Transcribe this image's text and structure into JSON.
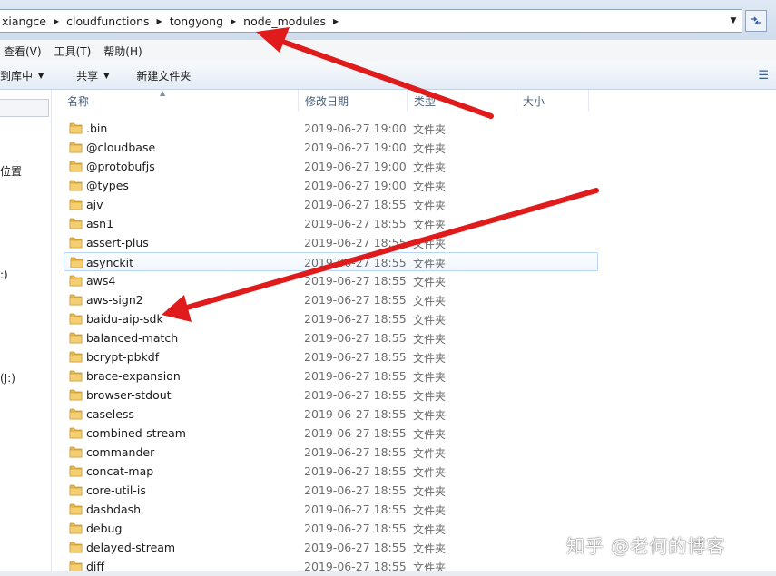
{
  "address_bar": {
    "crumbs": [
      "xiangce",
      "cloudfunctions",
      "tongyong",
      "node_modules"
    ]
  },
  "menu": [
    "查看(V)",
    "工具(T)",
    "帮助(H)"
  ],
  "toolbar": {
    "library_label": "到库中",
    "share_label": "共享",
    "new_folder_label": "新建文件夹"
  },
  "nav_pane": {
    "items": [
      "位置",
      ":)",
      "(J:)"
    ]
  },
  "columns": {
    "name": "名称",
    "date": "修改日期",
    "type": "类型",
    "size": "大小"
  },
  "files": [
    {
      "name": ".bin",
      "date": "2019-06-27 19:00",
      "type": "文件夹"
    },
    {
      "name": "@cloudbase",
      "date": "2019-06-27 19:00",
      "type": "文件夹"
    },
    {
      "name": "@protobufjs",
      "date": "2019-06-27 19:00",
      "type": "文件夹"
    },
    {
      "name": "@types",
      "date": "2019-06-27 19:00",
      "type": "文件夹"
    },
    {
      "name": "ajv",
      "date": "2019-06-27 18:55",
      "type": "文件夹"
    },
    {
      "name": "asn1",
      "date": "2019-06-27 18:55",
      "type": "文件夹"
    },
    {
      "name": "assert-plus",
      "date": "2019-06-27 18:55",
      "type": "文件夹"
    },
    {
      "name": "asynckit",
      "date": "2019-06-27 18:55",
      "type": "文件夹"
    },
    {
      "name": "aws4",
      "date": "2019-06-27 18:55",
      "type": "文件夹"
    },
    {
      "name": "aws-sign2",
      "date": "2019-06-27 18:55",
      "type": "文件夹"
    },
    {
      "name": "baidu-aip-sdk",
      "date": "2019-06-27 18:55",
      "type": "文件夹"
    },
    {
      "name": "balanced-match",
      "date": "2019-06-27 18:55",
      "type": "文件夹"
    },
    {
      "name": "bcrypt-pbkdf",
      "date": "2019-06-27 18:55",
      "type": "文件夹"
    },
    {
      "name": "brace-expansion",
      "date": "2019-06-27 18:55",
      "type": "文件夹"
    },
    {
      "name": "browser-stdout",
      "date": "2019-06-27 18:55",
      "type": "文件夹"
    },
    {
      "name": "caseless",
      "date": "2019-06-27 18:55",
      "type": "文件夹"
    },
    {
      "name": "combined-stream",
      "date": "2019-06-27 18:55",
      "type": "文件夹"
    },
    {
      "name": "commander",
      "date": "2019-06-27 18:55",
      "type": "文件夹"
    },
    {
      "name": "concat-map",
      "date": "2019-06-27 18:55",
      "type": "文件夹"
    },
    {
      "name": "core-util-is",
      "date": "2019-06-27 18:55",
      "type": "文件夹"
    },
    {
      "name": "dashdash",
      "date": "2019-06-27 18:55",
      "type": "文件夹"
    },
    {
      "name": "debug",
      "date": "2019-06-27 18:55",
      "type": "文件夹"
    },
    {
      "name": "delayed-stream",
      "date": "2019-06-27 18:55",
      "type": "文件夹"
    },
    {
      "name": "diff",
      "date": "2019-06-27 18:55",
      "type": "文件夹"
    }
  ],
  "selected_file": "asynckit",
  "watermark": "知乎 @老何的博客",
  "colors": {
    "annotation_arrow": "#e01b1b",
    "selection_border": "#b8d6fb",
    "folder": "#e8b84a"
  }
}
